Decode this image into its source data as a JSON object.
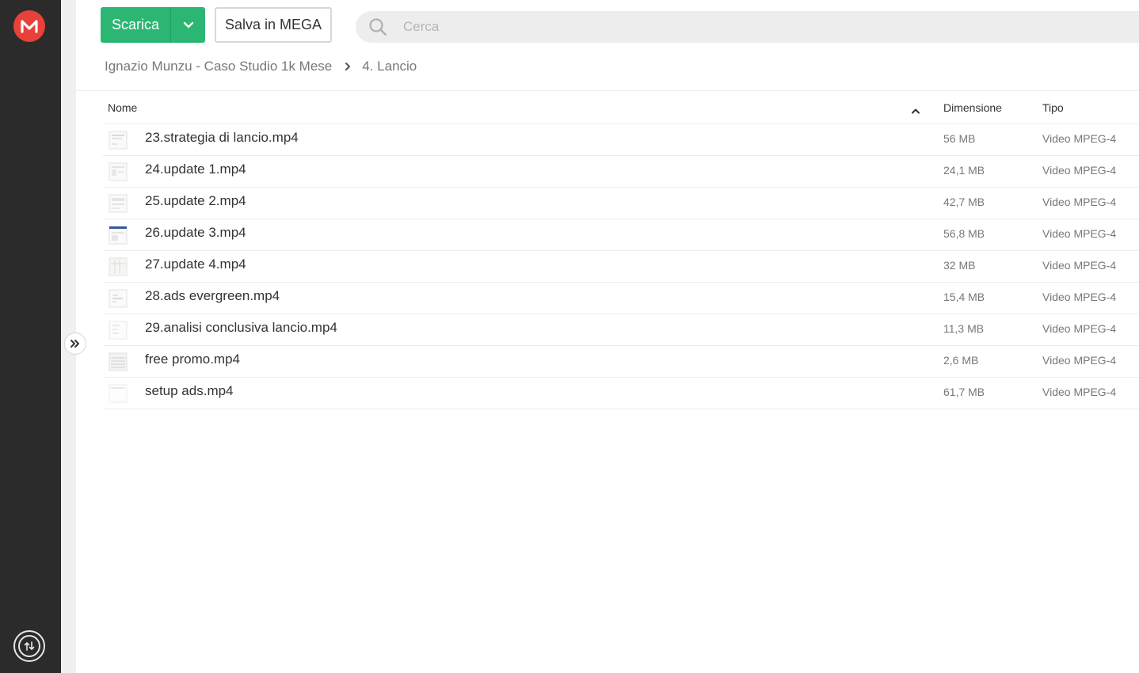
{
  "sidebar": {
    "logo_icon": "mega-logo-icon",
    "logo_color": "#e8413a",
    "transfer_icon": "transfers-icon"
  },
  "toolbar": {
    "download_label": "Scarica",
    "download_color": "#2bb673",
    "save_label": "Salva in MEGA"
  },
  "search": {
    "placeholder": "Cerca",
    "icon": "search-icon"
  },
  "breadcrumb": {
    "root": "Ignazio Munzu - Caso Studio 1k Mese",
    "current": "4. Lancio"
  },
  "table": {
    "columns": {
      "name": "Nome",
      "size": "Dimensione",
      "type": "Tipo"
    },
    "rows": [
      {
        "name": "23.strategia di lancio.mp4",
        "size": "56 MB",
        "type": "Video MPEG-4"
      },
      {
        "name": "24.update 1.mp4",
        "size": "24,1 MB",
        "type": "Video MPEG-4"
      },
      {
        "name": "25.update 2.mp4",
        "size": "42,7 MB",
        "type": "Video MPEG-4"
      },
      {
        "name": "26.update 3.mp4",
        "size": "56,8 MB",
        "type": "Video MPEG-4"
      },
      {
        "name": "27.update 4.mp4",
        "size": "32 MB",
        "type": "Video MPEG-4"
      },
      {
        "name": "28.ads evergreen.mp4",
        "size": "15,4 MB",
        "type": "Video MPEG-4"
      },
      {
        "name": "29.analisi conclusiva lancio.mp4",
        "size": "11,3 MB",
        "type": "Video MPEG-4"
      },
      {
        "name": "free promo.mp4",
        "size": "2,6 MB",
        "type": "Video MPEG-4"
      },
      {
        "name": "setup ads.mp4",
        "size": "61,7 MB",
        "type": "Video MPEG-4"
      }
    ]
  }
}
